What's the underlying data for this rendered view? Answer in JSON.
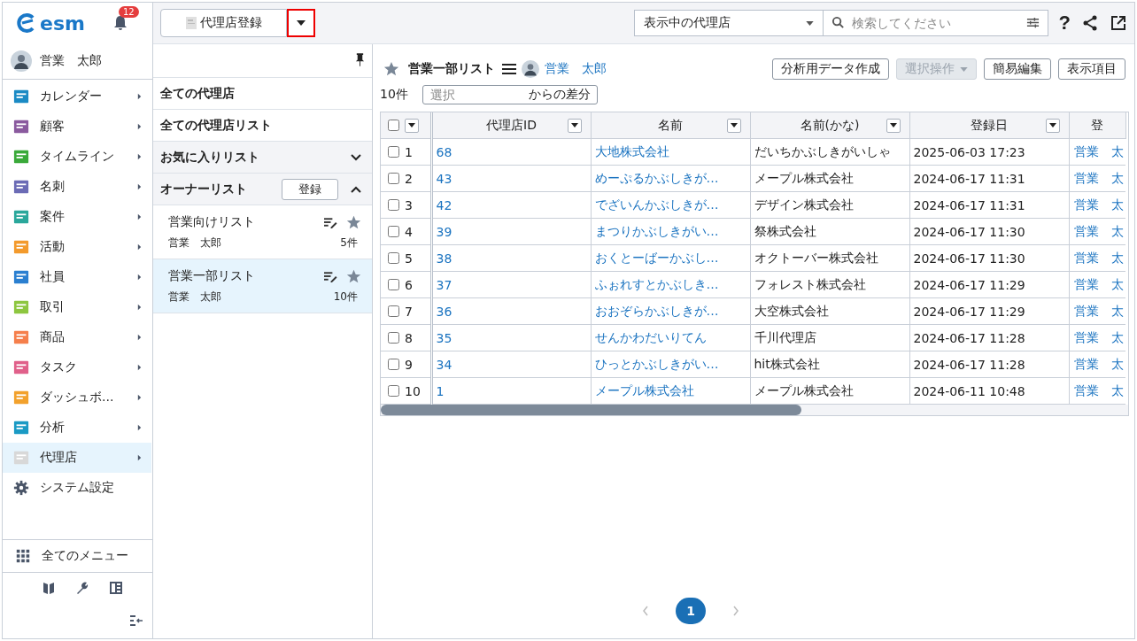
{
  "app": {
    "logo": "esm",
    "notifications": "12"
  },
  "user": {
    "name": "営業　太郎"
  },
  "menu": [
    {
      "label": "カレンダー",
      "submenu": true,
      "selected": false
    },
    {
      "label": "顧客",
      "submenu": true,
      "selected": false
    },
    {
      "label": "タイムライン",
      "submenu": true,
      "selected": false
    },
    {
      "label": "名刺",
      "submenu": true,
      "selected": false
    },
    {
      "label": "案件",
      "submenu": true,
      "selected": false
    },
    {
      "label": "活動",
      "submenu": true,
      "selected": false
    },
    {
      "label": "社員",
      "submenu": true,
      "selected": false
    },
    {
      "label": "取引",
      "submenu": true,
      "selected": false
    },
    {
      "label": "商品",
      "submenu": true,
      "selected": false
    },
    {
      "label": "タスク",
      "submenu": true,
      "selected": false
    },
    {
      "label": "ダッシュボ…",
      "submenu": true,
      "selected": false
    },
    {
      "label": "分析",
      "submenu": true,
      "selected": false
    },
    {
      "label": "代理店",
      "submenu": true,
      "selected": true
    },
    {
      "label": "システム設定",
      "submenu": false,
      "selected": false
    }
  ],
  "all_menu": "全てのメニュー",
  "toolbar": {
    "register_button": "代理店登録",
    "caret_highlighted": true,
    "scope_select": "表示中の代理店",
    "search": {
      "placeholder": "検索してください"
    },
    "help": "?"
  },
  "lists_panel": {
    "sections": [
      {
        "label": "全ての代理店",
        "kind": "link"
      },
      {
        "label": "全ての代理店リスト",
        "kind": "link"
      },
      {
        "label": "お気に入りリスト",
        "kind": "group",
        "expanded": false
      },
      {
        "label": "オーナーリスト",
        "kind": "group",
        "expanded": true,
        "button": "登録"
      }
    ],
    "items": [
      {
        "title": "営業向けリスト",
        "owner": "営業　太郎",
        "count": "5件",
        "selected": false
      },
      {
        "title": "営業一部リスト",
        "owner": "営業　太郎",
        "count": "10件",
        "selected": true
      }
    ]
  },
  "list_header": {
    "title": "営業一部リスト",
    "owner": "営業　太郎",
    "buttons": [
      {
        "label": "分析用データ作成",
        "disabled": false,
        "dropdown": false
      },
      {
        "label": "選択操作",
        "disabled": true,
        "dropdown": true
      },
      {
        "label": "簡易編集",
        "disabled": false,
        "dropdown": false
      },
      {
        "label": "表示項目",
        "disabled": false,
        "dropdown": false
      }
    ]
  },
  "count": "10件",
  "diff": {
    "placeholder": "選択",
    "suffix": "からの差分"
  },
  "table": {
    "select_all": false,
    "columns": [
      {
        "label": "代理店ID",
        "filter": true
      },
      {
        "label": "名前",
        "filter": true
      },
      {
        "label": "名前(かな)",
        "filter": true
      },
      {
        "label": "登録日",
        "filter": true
      },
      {
        "label": "登",
        "filter": false
      }
    ],
    "rows": [
      {
        "checked": false,
        "no": "1",
        "id": "68",
        "name": "大地株式会社",
        "kana": "だいちかぶしきがいしゃ",
        "date": "2025-06-03 17:23",
        "owner": "営業　太"
      },
      {
        "checked": false,
        "no": "2",
        "id": "43",
        "name": "めーぷるかぶしきが…",
        "kana": "メープル株式会社",
        "date": "2024-06-17 11:31",
        "owner": "営業　太"
      },
      {
        "checked": false,
        "no": "3",
        "id": "42",
        "name": "でざいんかぶしきが…",
        "kana": "デザイン株式会社",
        "date": "2024-06-17 11:31",
        "owner": "営業　太"
      },
      {
        "checked": false,
        "no": "4",
        "id": "39",
        "name": "まつりかぶしきがい…",
        "kana": "祭株式会社",
        "date": "2024-06-17 11:30",
        "owner": "営業　太"
      },
      {
        "checked": false,
        "no": "5",
        "id": "38",
        "name": "おくとーばーかぶし…",
        "kana": "オクトーバー株式会社",
        "date": "2024-06-17 11:30",
        "owner": "営業　太"
      },
      {
        "checked": false,
        "no": "6",
        "id": "37",
        "name": "ふぉれすとかぶしき…",
        "kana": "フォレスト株式会社",
        "date": "2024-06-17 11:29",
        "owner": "営業　太"
      },
      {
        "checked": false,
        "no": "7",
        "id": "36",
        "name": "おおぞらかぶしきが…",
        "kana": "大空株式会社",
        "date": "2024-06-17 11:29",
        "owner": "営業　太"
      },
      {
        "checked": false,
        "no": "8",
        "id": "35",
        "name": "せんかわだいりてん",
        "kana": "千川代理店",
        "date": "2024-06-17 11:28",
        "owner": "営業　太"
      },
      {
        "checked": false,
        "no": "9",
        "id": "34",
        "name": "ひっとかぶしきがい…",
        "kana": "hit株式会社",
        "date": "2024-06-17 11:28",
        "owner": "営業　太"
      },
      {
        "checked": false,
        "no": "10",
        "id": "1",
        "name": "メープル株式会社",
        "kana": "メープル株式会社",
        "date": "2024-06-11 10:48",
        "owner": "営業　太"
      }
    ]
  },
  "pagination": {
    "pages": [
      {
        "label": "1",
        "selected": true
      }
    ]
  }
}
